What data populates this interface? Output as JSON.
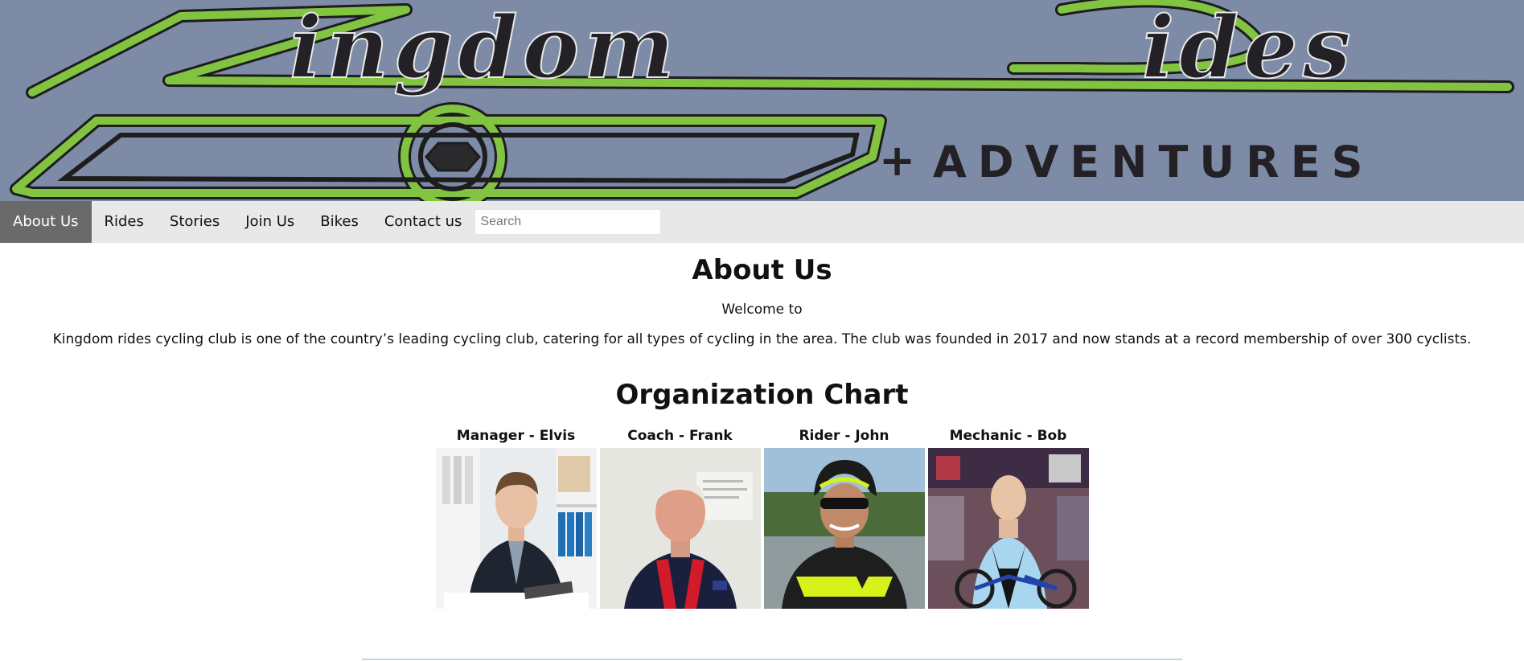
{
  "banner": {
    "logo_text": "Kingdom Rides",
    "tagline": "+ADVENTURES",
    "colors": {
      "background": "#7d8ba7",
      "logo_green": "#82c341",
      "logo_dark": "#222024"
    }
  },
  "nav": {
    "items": [
      {
        "label": "About Us",
        "active": true
      },
      {
        "label": "Rides",
        "active": false
      },
      {
        "label": "Stories",
        "active": false
      },
      {
        "label": "Join Us",
        "active": false
      },
      {
        "label": "Bikes",
        "active": false
      },
      {
        "label": "Contact us",
        "active": false
      }
    ],
    "search_placeholder": "Search",
    "search_value": ""
  },
  "page": {
    "title": "About Us",
    "welcome": "Welcome to",
    "intro": "Kingdom rides cycling club is one of the country’s leading cycling club, catering for all types of cycling in the area. The club was founded in 2017 and now stands at a record membership of over 300 cyclists."
  },
  "org_chart": {
    "title": "Organization Chart",
    "members": [
      {
        "label": "Manager - Elvis"
      },
      {
        "label": "Coach - Frank"
      },
      {
        "label": "Rider - John"
      },
      {
        "label": "Mechanic - Bob"
      }
    ]
  }
}
